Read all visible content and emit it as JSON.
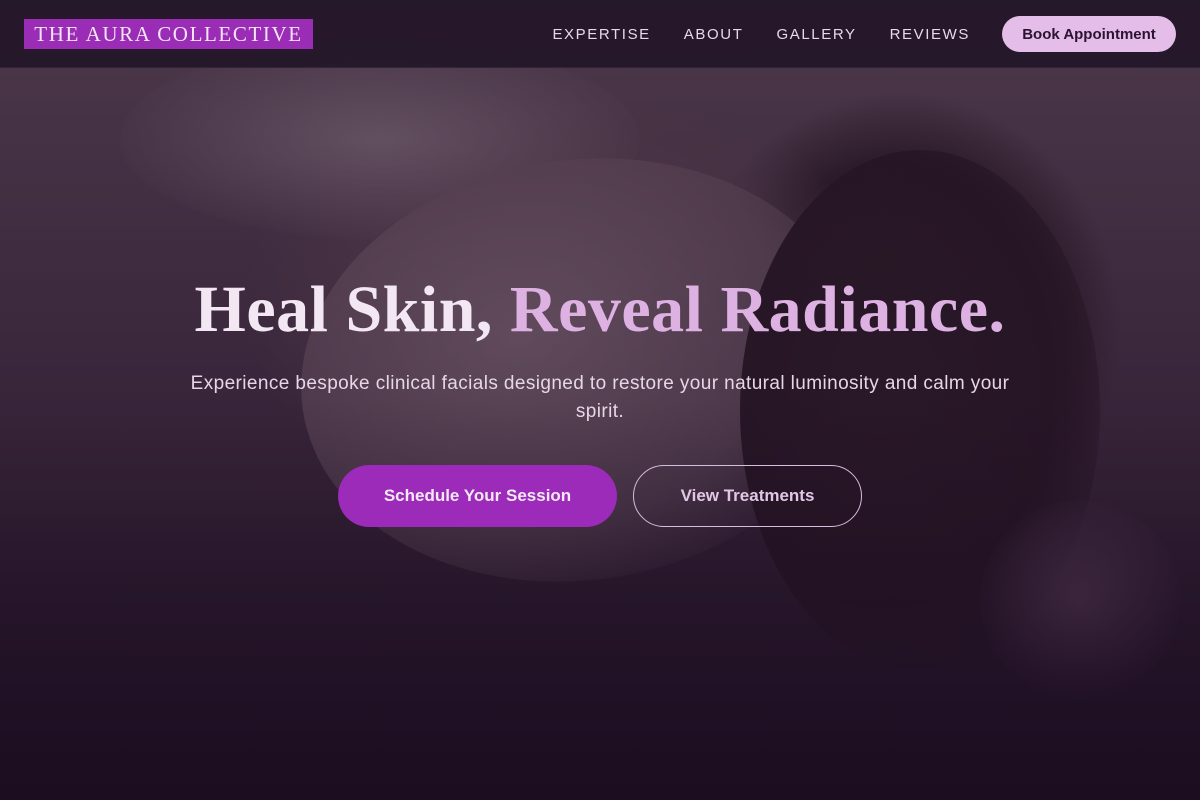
{
  "brand": {
    "name": "THE AURA COLLECTIVE",
    "color": "#9a2cb5"
  },
  "nav": {
    "links": [
      {
        "label": "EXPERTISE"
      },
      {
        "label": "ABOUT"
      },
      {
        "label": "GALLERY"
      },
      {
        "label": "REVIEWS"
      }
    ],
    "book_label": "Book Appointment"
  },
  "hero": {
    "headline_main": "Heal Skin, ",
    "headline_accent": "Reveal Radiance.",
    "subtitle": "Experience bespoke clinical facials designed to restore your natural luminosity and calm your spirit.",
    "primary_cta": "Schedule Your Session",
    "secondary_cta": "View Treatments",
    "accent_color": "#ddb2e3"
  }
}
